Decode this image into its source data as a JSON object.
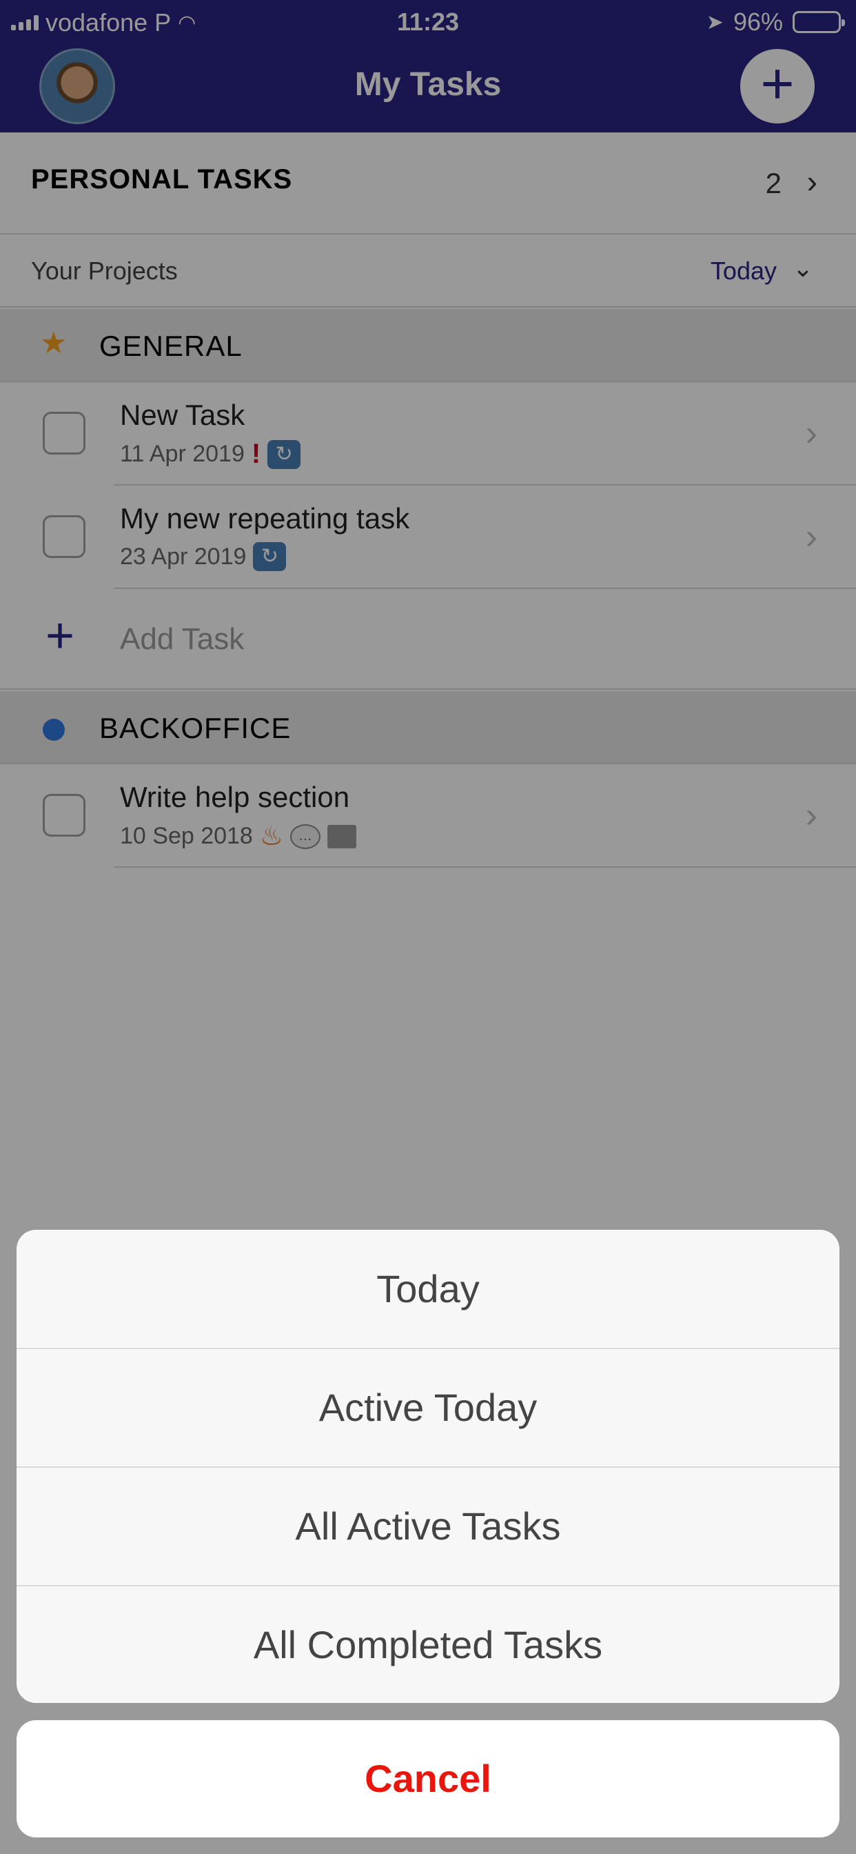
{
  "status_bar": {
    "carrier": "vodafone P",
    "time": "11:23",
    "battery": "96%",
    "battery_level": 0.96
  },
  "nav": {
    "title": "My Tasks",
    "add_label": "+"
  },
  "personal": {
    "label": "PERSONAL TASKS",
    "count": "2"
  },
  "projects": {
    "label": "Your Projects",
    "filter": "Today"
  },
  "sections": [
    {
      "title": "GENERAL",
      "icon": "star-icon",
      "color": "#f59f1c",
      "tasks": [
        {
          "name": "New Task",
          "date": "11 Apr 2019",
          "flags": [
            "exclamation-icon",
            "repeat-icon"
          ]
        },
        {
          "name": "My new repeating task",
          "date": "23 Apr 2019",
          "flags": [
            "repeat-icon"
          ]
        }
      ],
      "add_task": "Add Task"
    },
    {
      "title": "BACKOFFICE",
      "icon": "dot-icon",
      "color": "#2f7ae0",
      "tasks": [
        {
          "name": "Write help section",
          "date": "10 Sep 2018",
          "flags": [
            "fire-icon",
            "speech-bubble-icon",
            "notebook-icon"
          ]
        }
      ]
    }
  ],
  "action_sheet": {
    "options": [
      "Today",
      "Active Today",
      "All Active Tasks",
      "All Completed Tasks"
    ],
    "cancel": "Cancel"
  },
  "colors": {
    "nav_background": "#2a2483",
    "cancel_text": "#e8160c"
  }
}
